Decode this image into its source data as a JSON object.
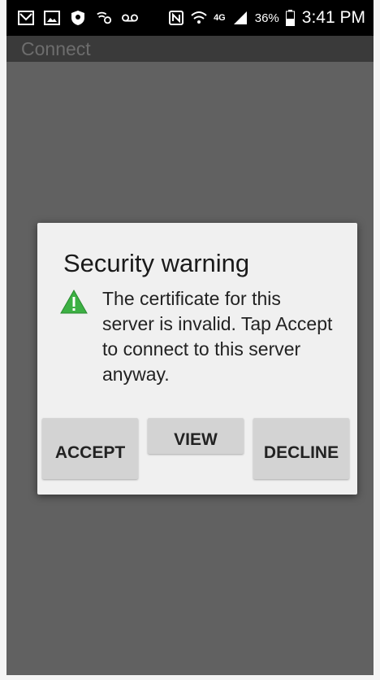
{
  "status_bar": {
    "left_icons": [
      "gmail-icon",
      "gallery-icon",
      "shield-icon",
      "wifi-calling-icon",
      "voicemail-icon"
    ],
    "right_icons": [
      "nfc-icon",
      "wifi-icon",
      "lte-icon",
      "signal-icon",
      "battery-icon"
    ],
    "network_type": "4G",
    "battery_percent": "36%",
    "time": "3:41 PM"
  },
  "app": {
    "title": "Connect"
  },
  "dialog": {
    "title": "Security warning",
    "icon": "warning-triangle-icon",
    "message": "The certificate for this server is invalid. Tap Accept to connect to this server anyway.",
    "buttons": {
      "accept": "ACCEPT",
      "view": "VIEW",
      "decline": "DECLINE"
    }
  },
  "colors": {
    "background": "#616161",
    "dialog": "#f0f0f0",
    "button": "#d3d3d3",
    "warning_icon": "#3cb043"
  }
}
